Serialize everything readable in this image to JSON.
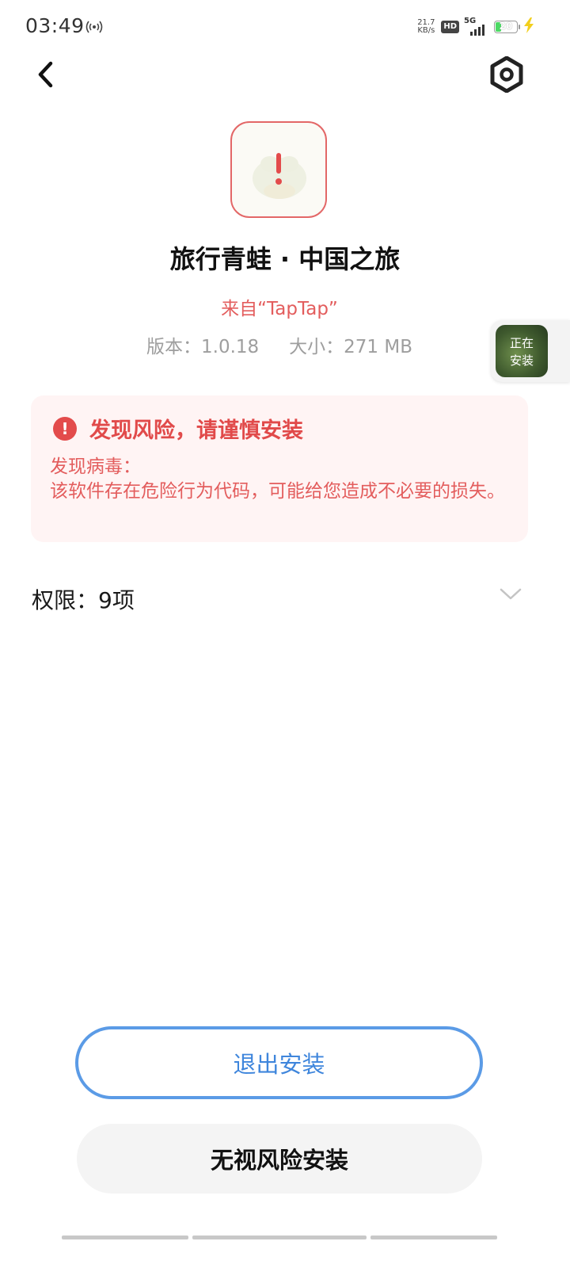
{
  "status_bar": {
    "time": "03:49",
    "net_speed_value": "21.7",
    "net_speed_unit": "KB/s",
    "hd_label": "HD",
    "network_type": "5G",
    "battery_level": "20"
  },
  "app": {
    "title": "旅行青蛙 · 中国之旅",
    "source": "来自“TapTap”",
    "version": "版本：1.0.18",
    "size": "大小：271 MB"
  },
  "installing_badge": {
    "line1": "正在",
    "line2": "安装"
  },
  "risk": {
    "title": "发现风险，请谨慎安装",
    "detail_heading": "发现病毒：",
    "detail_body": "该软件存在危险行为代码，可能给您造成不必要的损失。"
  },
  "permissions": {
    "label": "权限：9项"
  },
  "buttons": {
    "exit": "退出安装",
    "ignore": "无视风险安装"
  },
  "colors": {
    "risk_red": "#e14a4a",
    "risk_bg": "#fff4f4",
    "accent_blue": "#5b9be6",
    "meta_gray": "#9e9e9e"
  }
}
